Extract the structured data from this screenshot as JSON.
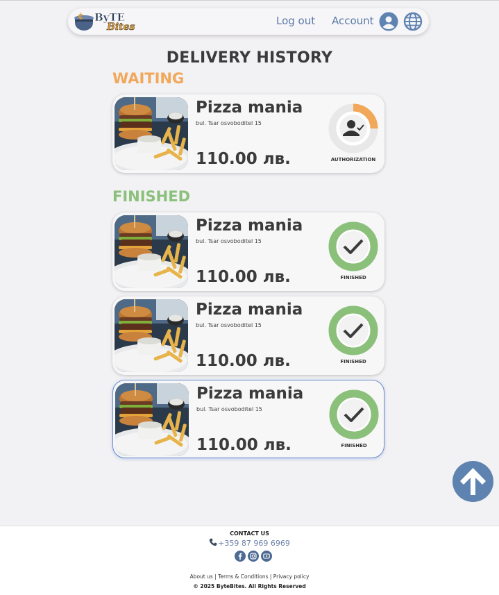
{
  "header": {
    "logo_text": "ByteBites",
    "logout_label": "Log out",
    "account_label": "Account",
    "icons": [
      "user-icon",
      "globe-icon"
    ]
  },
  "page": {
    "title": "DELIVERY HISTORY"
  },
  "sections": {
    "waiting_title": "WAITING",
    "finished_title": "FINISHED"
  },
  "orders": [
    {
      "restaurant": "Pizza mania",
      "address": "bul. Tsar osvoboditel 15",
      "price": "110.00 лв.",
      "status": "AUTHORIZATION",
      "status_icon": "user-check-icon",
      "progress": 0.25,
      "color": "#f2a85a"
    },
    {
      "restaurant": "Pizza mania",
      "address": "bul. Tsar osvoboditel 15",
      "price": "110.00 лв.",
      "status": "FINISHED",
      "status_icon": "checkmark-icon",
      "progress": 1.0,
      "color": "#8bc07b"
    },
    {
      "restaurant": "Pizza mania",
      "address": "bul. Tsar osvoboditel 15",
      "price": "110.00 лв.",
      "status": "FINISHED",
      "status_icon": "checkmark-icon",
      "progress": 1.0,
      "color": "#8bc07b"
    },
    {
      "restaurant": "Pizza mania",
      "address": "bul. Tsar osvoboditel 15",
      "price": "110.00 лв.",
      "status": "FINISHED",
      "status_icon": "checkmark-icon",
      "progress": 1.0,
      "color": "#8bc07b"
    }
  ],
  "footer": {
    "contact_title": "CONTACT US",
    "phone": "+359 87 969 6969",
    "socials": [
      "facebook-icon",
      "instagram-icon",
      "youtube-icon"
    ],
    "links": "About us | Terms & Conditions | Privacy policy",
    "copyright": "© 2025 ByteBites. All Rights Reserved"
  },
  "colors": {
    "accent": "#5e83b1",
    "waiting": "#f2a85a",
    "finished": "#8bc07b",
    "background": "#f2f1f3"
  }
}
